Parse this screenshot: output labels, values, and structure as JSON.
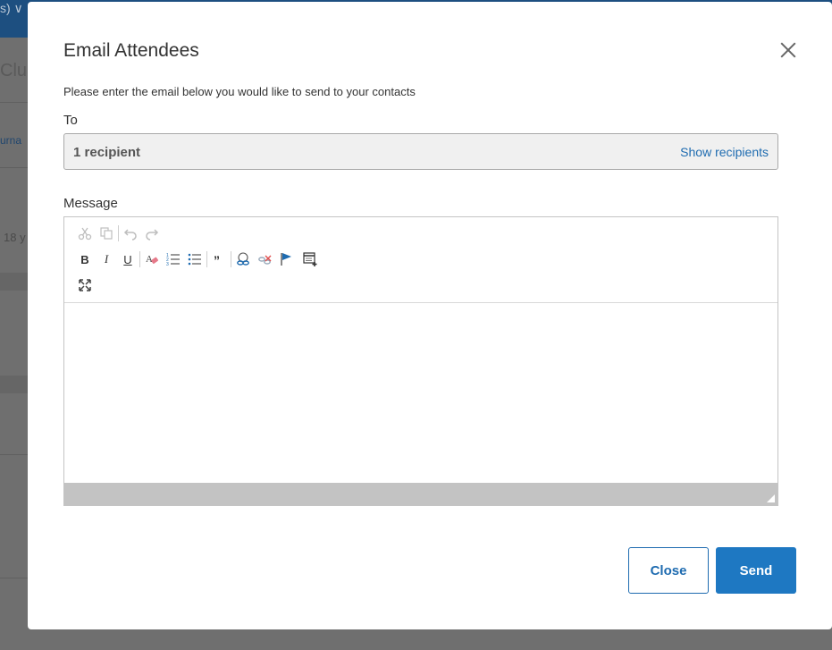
{
  "background": {
    "header_fragment": "s)  ∨",
    "club_fragment": "Club",
    "tab_fragment": "urna",
    "age_fragment": "18 y"
  },
  "modal": {
    "title": "Email Attendees",
    "instructions": "Please enter the email below you would like to send to your contacts",
    "to_label": "To",
    "recipients_count": "1 recipient",
    "show_recipients": "Show recipients",
    "message_label": "Message",
    "close_button": "Close",
    "send_button": "Send"
  },
  "toolbar": {
    "bold": "B",
    "italic": "I",
    "underline": "U"
  },
  "colors": {
    "primary": "#1e78c2",
    "link": "#1e6bb0",
    "header_bg": "#1d4f80"
  }
}
